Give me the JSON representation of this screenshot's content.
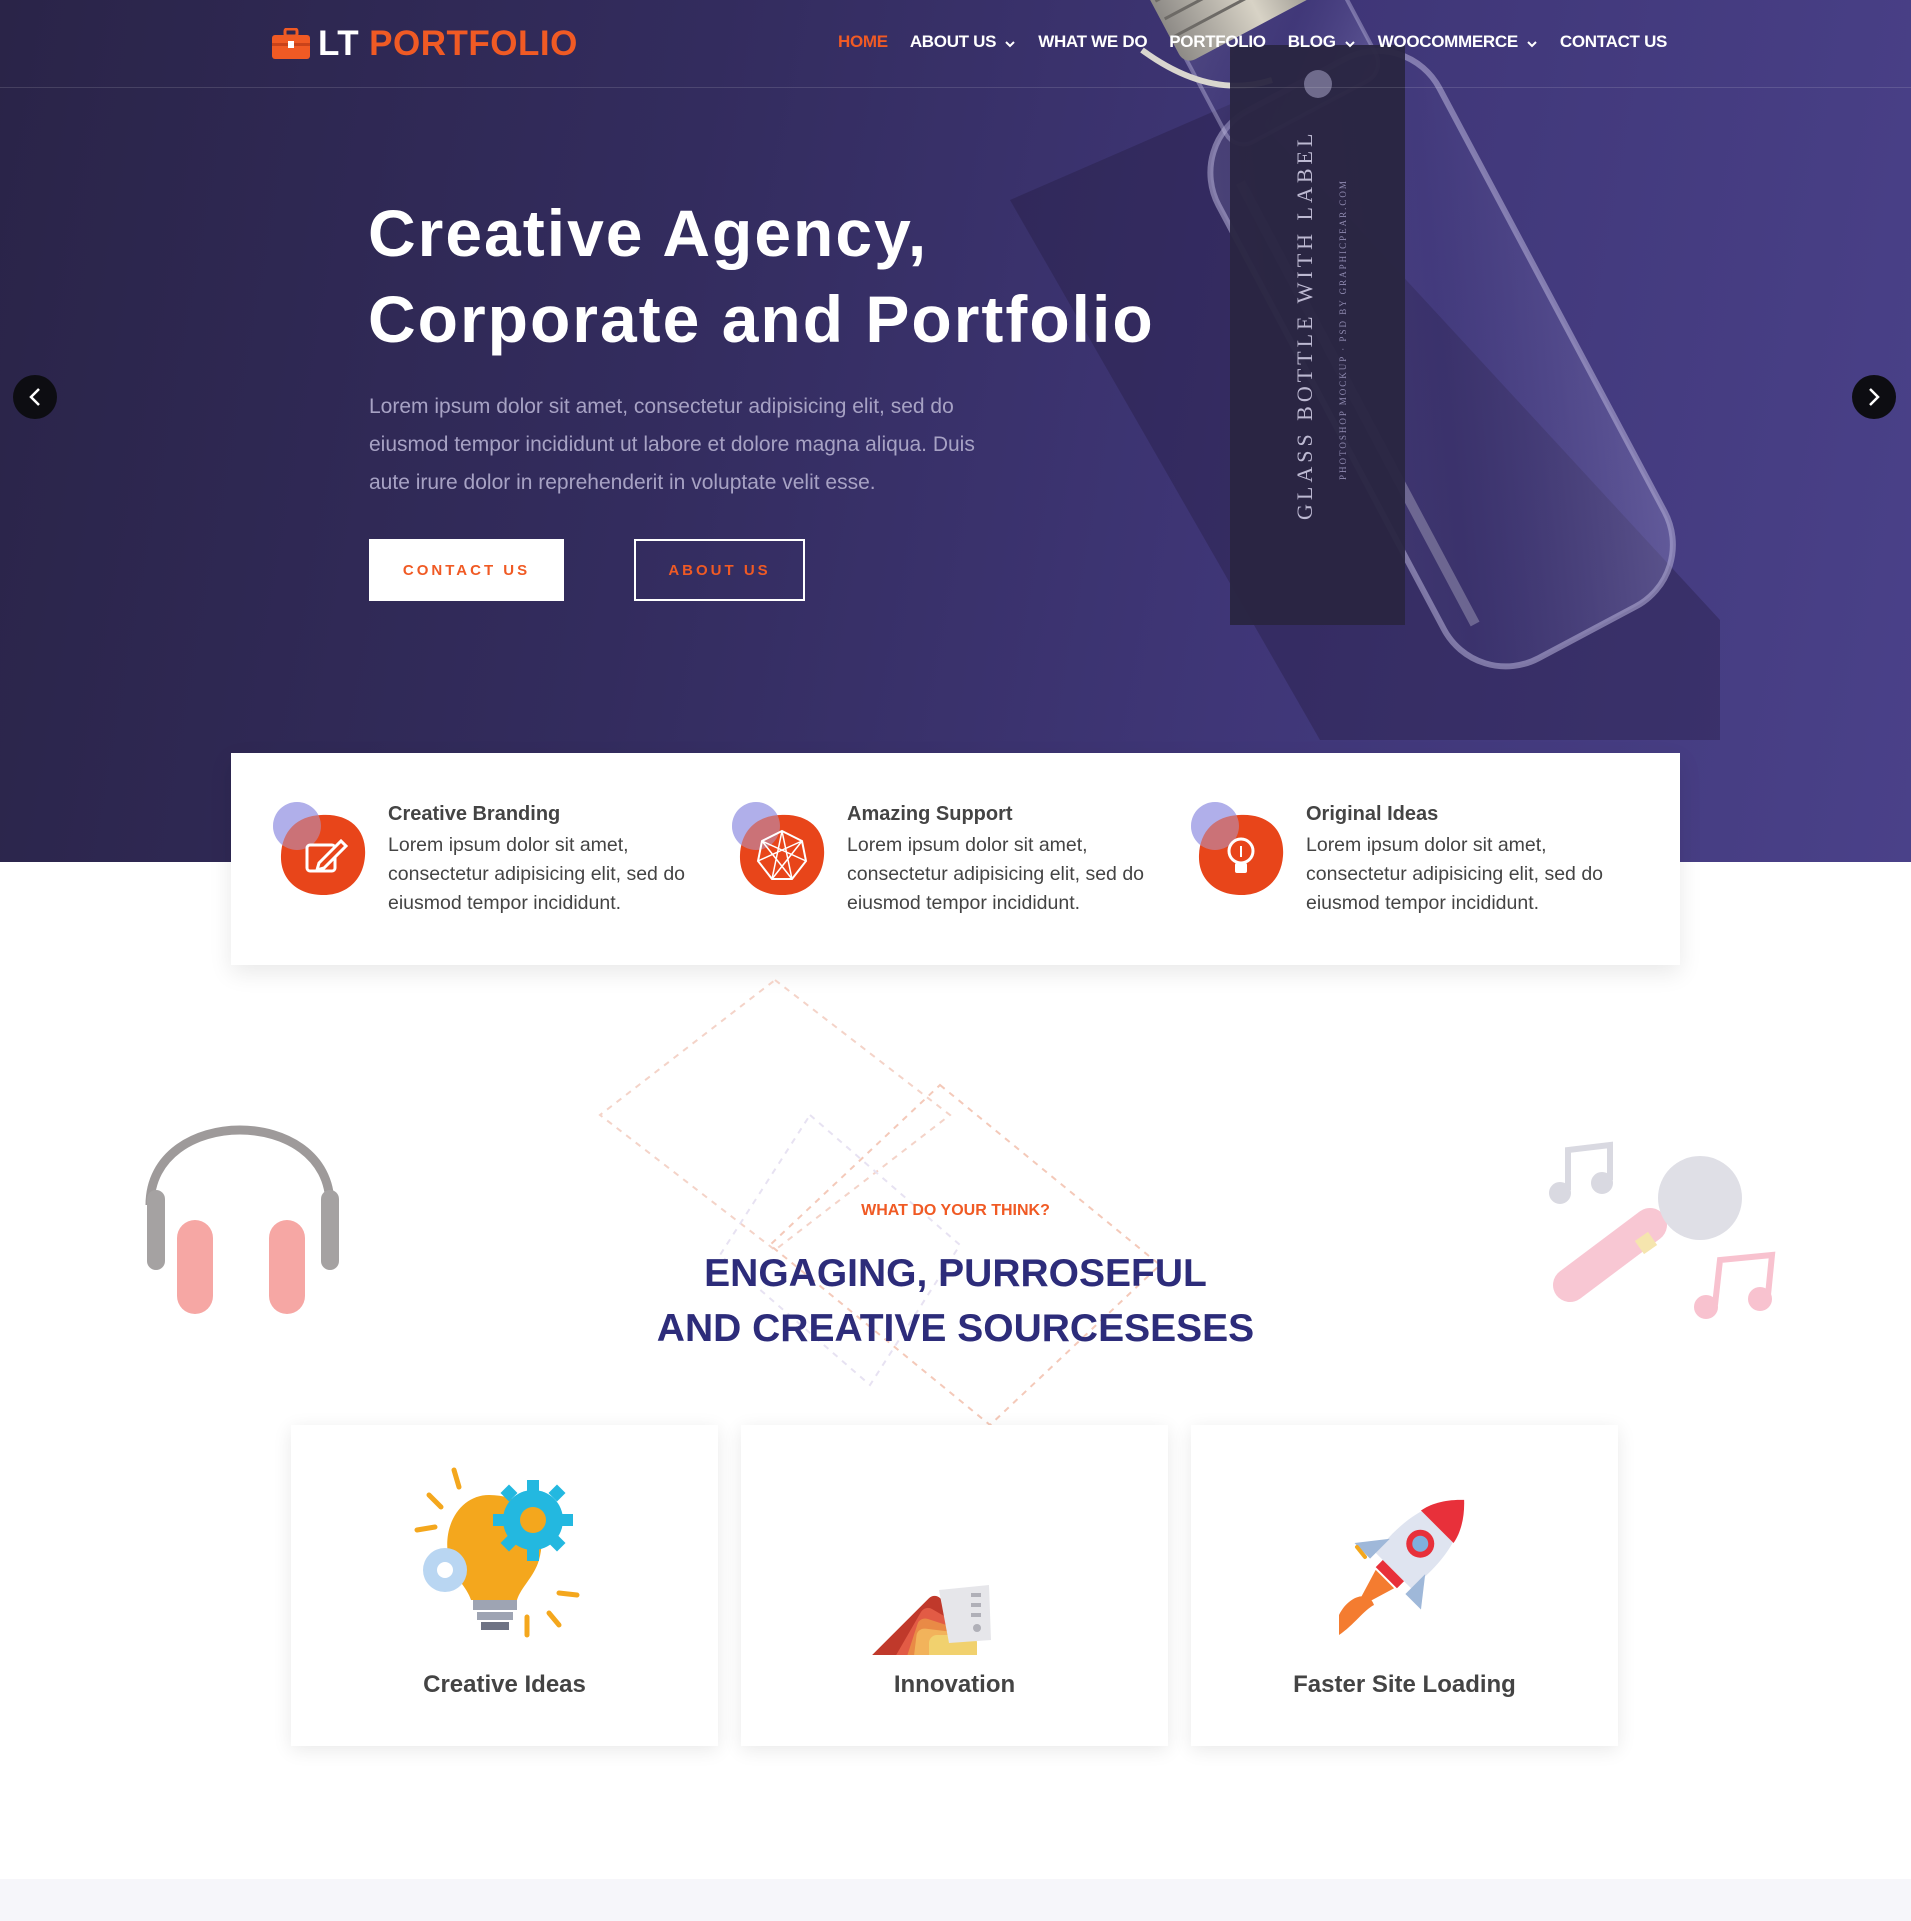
{
  "brand": {
    "name_lt": "LT",
    "name_portfolio": "PORTFOLIO",
    "accent": "#f05a24",
    "heading_color": "#2d2c7a"
  },
  "nav": {
    "items": [
      {
        "label": "HOME",
        "active": true,
        "dropdown": false
      },
      {
        "label": "ABOUT US",
        "active": false,
        "dropdown": true
      },
      {
        "label": "WHAT WE DO",
        "active": false,
        "dropdown": false
      },
      {
        "label": "PORTFOLIO",
        "active": false,
        "dropdown": false
      },
      {
        "label": "BLOG",
        "active": false,
        "dropdown": true
      },
      {
        "label": "WOOCOMMERCE",
        "active": false,
        "dropdown": true
      },
      {
        "label": "CONTACT US",
        "active": false,
        "dropdown": false
      }
    ]
  },
  "hero": {
    "title_line1": "Creative Agency,",
    "title_line2": "Corporate and Portfolio",
    "text": "Lorem ipsum dolor sit amet, consectetur adipisicing elit, sed do eiusmod tempor incididunt ut labore et dolore magna aliqua. Duis aute irure dolor in reprehenderit in voluptate velit esse.",
    "btn_contact": "CONTACT US",
    "btn_about": "ABOUT US",
    "bottle_label": "GLASS BOTTLE WITH LABEL",
    "bottle_sublabel": "PHOTOSHOP MOCKUP · PSD BY GRAPHICPEAR.COM"
  },
  "features": [
    {
      "title": "Creative Branding",
      "text": "Lorem ipsum dolor sit amet, consectetur adipisicing elit, sed do eiusmod tempor incididunt.",
      "icon": "edit-icon"
    },
    {
      "title": "Amazing Support",
      "text": "Lorem ipsum dolor sit amet, consectetur adipisicing elit, sed do eiusmod tempor incididunt.",
      "icon": "polyhedron-icon"
    },
    {
      "title": "Original Ideas",
      "text": "Lorem ipsum dolor sit amet, consectetur adipisicing elit, sed do eiusmod tempor incididunt.",
      "icon": "lightbulb-icon"
    }
  ],
  "section": {
    "kicker": "WHAT DO YOUR THINK?",
    "title_line1": "ENGAGING, PURROSEFUL",
    "title_line2": "AND CREATIVE SOURCESESES"
  },
  "cards": [
    {
      "title": "Creative Ideas",
      "icon": "lightbulb-gears-icon"
    },
    {
      "title": "Innovation",
      "icon": "color-swatch-icon"
    },
    {
      "title": "Faster Site Loading",
      "icon": "rocket-icon"
    }
  ]
}
